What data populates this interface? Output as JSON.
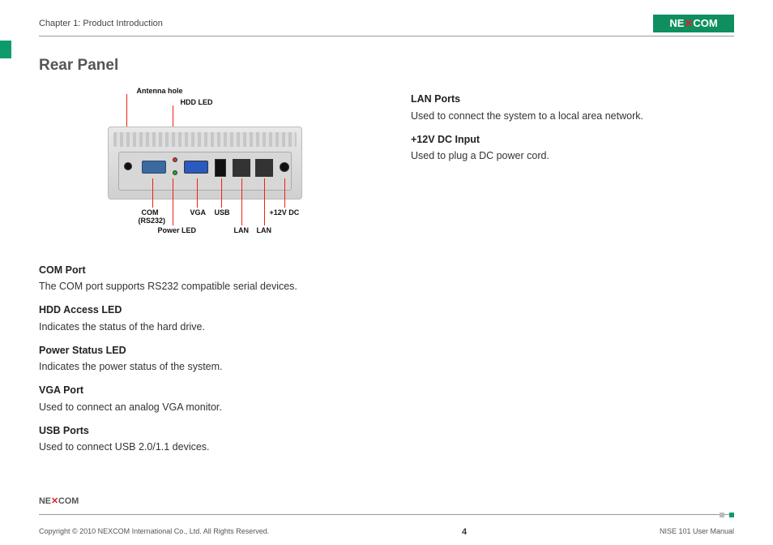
{
  "brand": "NEXCOM",
  "header": {
    "chapter": "Chapter 1: Product Introduction"
  },
  "section": {
    "title": "Rear Panel"
  },
  "diagram": {
    "labels": {
      "antenna": "Antenna hole",
      "hdd_led": "HDD LED",
      "com": "COM",
      "com_sub": "(RS232)",
      "power_led": "Power LED",
      "vga": "VGA",
      "usb": "USB",
      "lan": "LAN",
      "dc": "+12V DC"
    }
  },
  "left_items": [
    {
      "head": "COM Port",
      "body": "The COM port supports RS232 compatible serial devices."
    },
    {
      "head": "HDD Access LED",
      "body": "Indicates the status of the hard drive."
    },
    {
      "head": "Power Status LED",
      "body": "Indicates the power status of the system."
    },
    {
      "head": "VGA Port",
      "body": "Used to connect an analog VGA monitor."
    },
    {
      "head": "USB Ports",
      "body": "Used to connect USB 2.0/1.1 devices."
    }
  ],
  "right_items": [
    {
      "head": "LAN Ports",
      "body": "Used to connect the system to a local area network."
    },
    {
      "head": "+12V DC Input",
      "body": "Used to plug a DC power cord."
    }
  ],
  "footer": {
    "copyright": "Copyright © 2010 NEXCOM International Co., Ltd. All Rights Reserved.",
    "page": "4",
    "doc": "NISE 101 User Manual"
  }
}
